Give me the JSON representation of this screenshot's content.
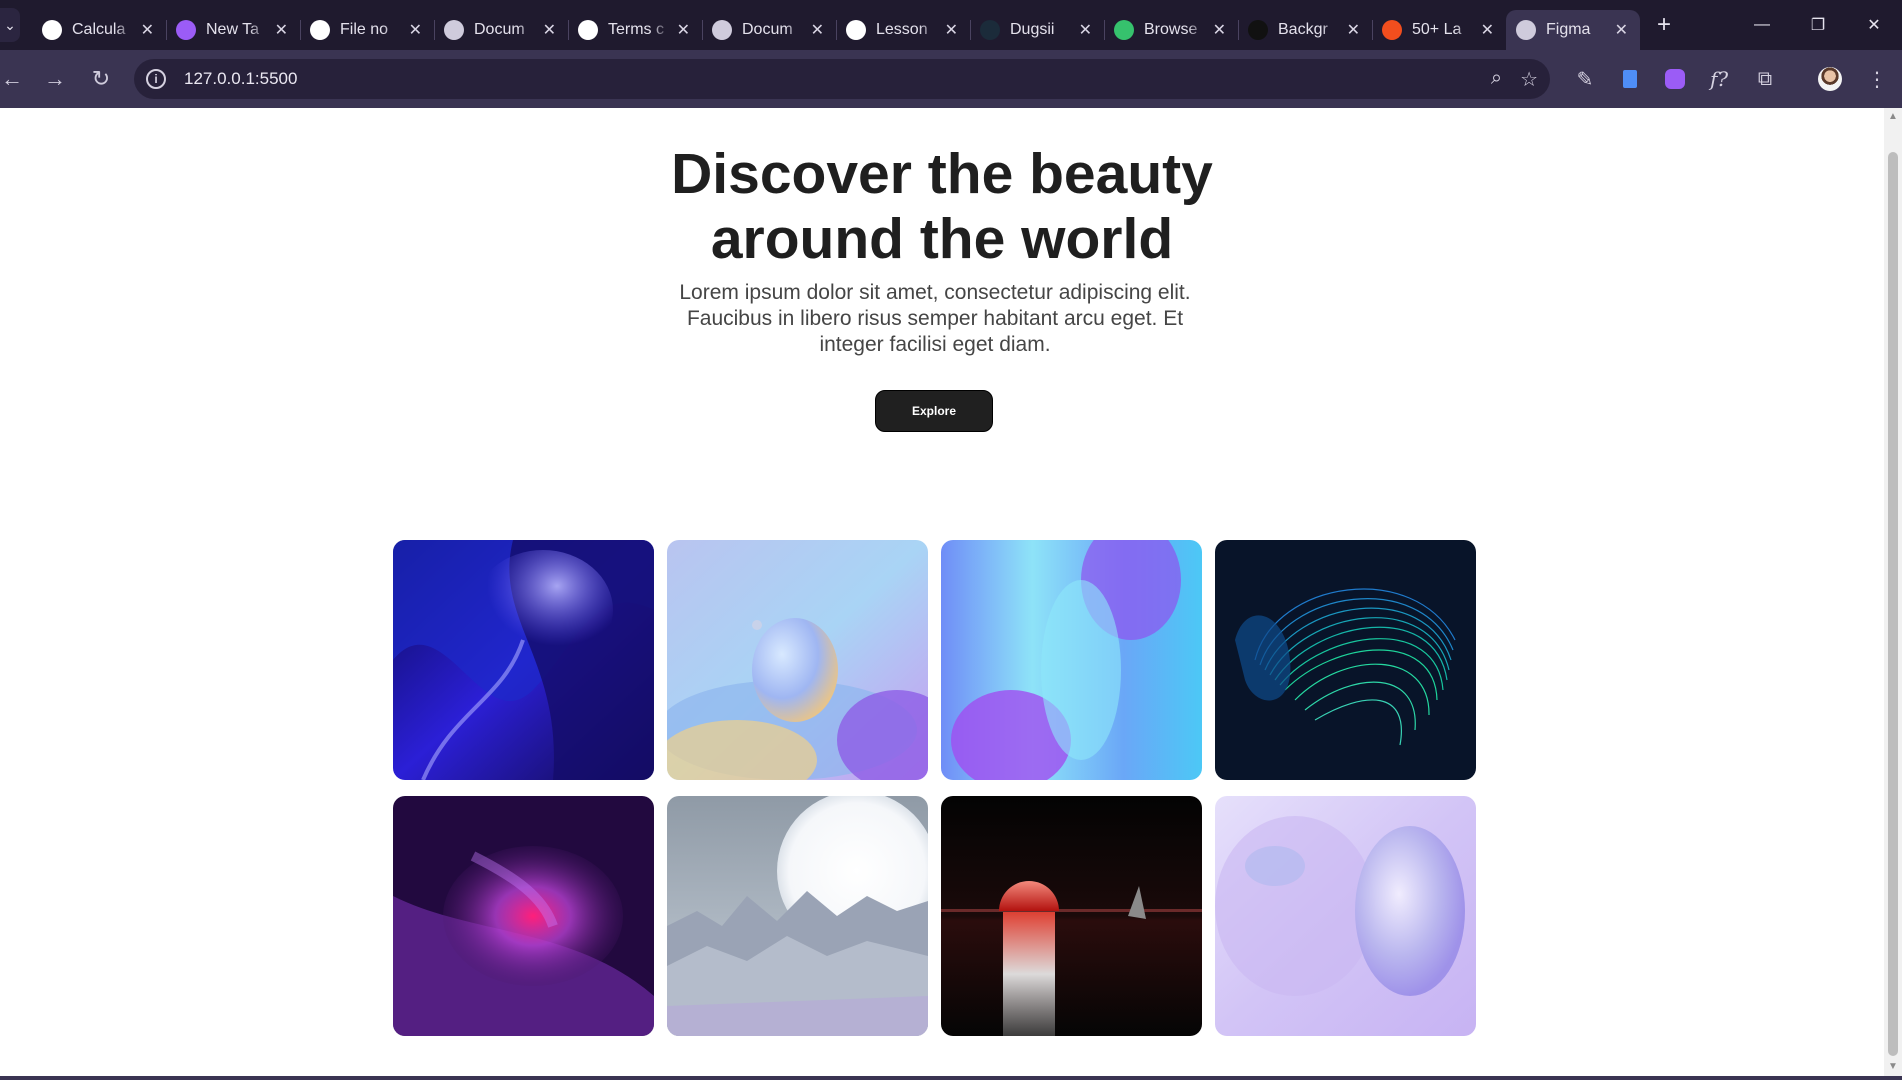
{
  "browser": {
    "tabs": [
      {
        "title": "Calcula",
        "icon": "github-icon",
        "color": "#ffffff"
      },
      {
        "title": "New Ta",
        "icon": "new-tab-extension-icon",
        "color": "#9b5cf6"
      },
      {
        "title": "File no",
        "icon": "github-icon",
        "color": "#ffffff"
      },
      {
        "title": "Docum",
        "icon": "globe-icon",
        "color": "#cfcbdc"
      },
      {
        "title": "Terms c",
        "icon": "openai-icon",
        "color": "#ffffff"
      },
      {
        "title": "Docum",
        "icon": "globe-icon",
        "color": "#cfcbdc"
      },
      {
        "title": "Lesson",
        "icon": "notion-icon",
        "color": "#ffffff"
      },
      {
        "title": "Dugsii",
        "icon": "dugsiiye-icon",
        "color": "#1b2b3a"
      },
      {
        "title": "Browse",
        "icon": "browse-icon",
        "color": "#36c26d"
      },
      {
        "title": "Backgr",
        "icon": "unsplash-icon",
        "color": "#111111"
      },
      {
        "title": "50+ La",
        "icon": "figma-icon",
        "color": "#f24e1e"
      },
      {
        "title": "Figma",
        "icon": "globe-icon",
        "color": "#cfcbdc",
        "active": true
      }
    ],
    "url": "127.0.0.1:5500"
  },
  "hero": {
    "title_line1": "Discover the beauty",
    "title_line2": "around the world",
    "subtitle": "Lorem ipsum dolor sit amet, consectetur adipiscing elit. Faucibus in libero risus semper habitant arcu eget. Et integer facilisi eget diam.",
    "button_label": "Explore"
  },
  "gallery": {
    "images": [
      "blue-waves-image",
      "pastel-sphere-image",
      "blue-purple-gradient-image",
      "teal-wire-spiral-image",
      "pink-glow-image",
      "moon-mountains-image",
      "red-sunset-image",
      "lavender-bubble-image"
    ]
  },
  "colors": {
    "chrome_dark": "#1f1a2e",
    "chrome_toolbar": "#3a3452",
    "button_bg": "#202020",
    "title_text": "#1f1f1f"
  }
}
